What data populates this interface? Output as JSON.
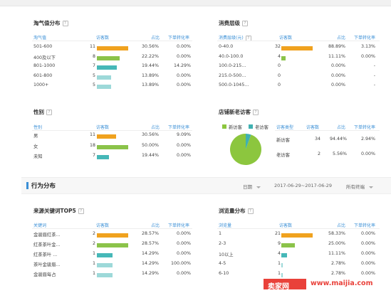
{
  "colors": {
    "accent_blue": "#3a8fd6",
    "bar_orange": "#f0a21f",
    "bar_green": "#8bc34a",
    "bar_teal": "#46b8b8",
    "bar_lightteal": "#9dd9d9",
    "pie_teal": "#3fb1b1",
    "pie_green": "#8cc63e",
    "watermark_red": "#e9413a"
  },
  "naughty": {
    "title": "淘气值分布",
    "help": "?",
    "headers": {
      "label": "淘气值",
      "visitors": "访客数",
      "share": "占比",
      "conversion": "下单转化率"
    },
    "rows": [
      {
        "label": "501-600",
        "visitors": "11",
        "share": "30.56%",
        "conversion": "0.00%",
        "value": 11,
        "color": "orange"
      },
      {
        "label": "400及以下",
        "visitors": "8",
        "share": "22.22%",
        "conversion": "0.00%",
        "value": 8,
        "color": "green"
      },
      {
        "label": "801-1000",
        "visitors": "7",
        "share": "19.44%",
        "conversion": "14.29%",
        "value": 7,
        "color": "teal"
      },
      {
        "label": "601-800",
        "visitors": "5",
        "share": "13.89%",
        "conversion": "0.00%",
        "value": 5,
        "color": "lightteal"
      },
      {
        "label": "1000+",
        "visitors": "5",
        "share": "13.89%",
        "conversion": "0.00%",
        "value": 5,
        "color": "lightteal"
      }
    ]
  },
  "spending": {
    "title": "消费层级",
    "help": "?",
    "headers": {
      "label": "消费层级(元)",
      "help": "?",
      "visitors": "访客数",
      "share": "占比",
      "conversion": "下单转化率"
    },
    "rows": [
      {
        "label": "0-40.0",
        "visitors": "32",
        "share": "88.89%",
        "conversion": "3.13%",
        "value": 32,
        "color": "orange"
      },
      {
        "label": "40.0-100.0",
        "visitors": "4",
        "share": "11.11%",
        "conversion": "0.00%",
        "value": 4,
        "color": "green"
      },
      {
        "label": "100.0-215...",
        "visitors": "0",
        "share": "0.00%",
        "conversion": "-",
        "value": 0,
        "color": "teal"
      },
      {
        "label": "215.0-500...",
        "visitors": "0",
        "share": "0.00%",
        "conversion": "-",
        "value": 0,
        "color": "teal"
      },
      {
        "label": "500.0-1045...",
        "visitors": "0",
        "share": "0.00%",
        "conversion": "-",
        "value": 0,
        "color": "teal"
      }
    ]
  },
  "gender": {
    "title": "性别",
    "help": "?",
    "headers": {
      "label": "性别",
      "visitors": "访客数",
      "share": "占比",
      "conversion": "下单转化率"
    },
    "rows": [
      {
        "label": "男",
        "visitors": "11",
        "share": "30.56%",
        "conversion": "9.09%",
        "value": 11,
        "color": "orange"
      },
      {
        "label": "女",
        "visitors": "18",
        "share": "50.00%",
        "conversion": "0.00%",
        "value": 18,
        "color": "green"
      },
      {
        "label": "未知",
        "visitors": "7",
        "share": "19.44%",
        "conversion": "0.00%",
        "value": 7,
        "color": "teal"
      }
    ]
  },
  "newold": {
    "title": "店铺新老访客",
    "help": "?",
    "legend": {
      "new": "新访客",
      "old": "老访客"
    },
    "headers": {
      "label": "访客类型",
      "visitors": "访客数",
      "share": "占比",
      "conversion": "下单转化率"
    },
    "rows": [
      {
        "label": "新访客",
        "visitors": "34",
        "share": "94.44%",
        "conversion": "2.94%"
      },
      {
        "label": "老访客",
        "visitors": "2",
        "share": "5.56%",
        "conversion": "0.00%"
      }
    ],
    "pie": {
      "new_share": 94.44,
      "old_share": 5.56
    }
  },
  "behavior": {
    "title": "行为分布",
    "date_granularity": "日期",
    "date_range": "2017-06-29~2017-06-29",
    "terminal": "所有终端"
  },
  "keywords": {
    "title": "来源关键词TOP5",
    "help": "?",
    "headers": {
      "label": "关键词",
      "visitors": "访客数",
      "share": "占比",
      "conversion": "下单转化率"
    },
    "rows": [
      {
        "label": "金骏眉红茶...",
        "visitors": "2",
        "share": "28.57%",
        "conversion": "0.00%",
        "value": 2,
        "color": "orange"
      },
      {
        "label": "红茶茶叶金...",
        "visitors": "2",
        "share": "28.57%",
        "conversion": "0.00%",
        "value": 2,
        "color": "green"
      },
      {
        "label": "红茶茶叶 ...",
        "visitors": "1",
        "share": "14.29%",
        "conversion": "0.00%",
        "value": 1,
        "color": "teal"
      },
      {
        "label": "茶叶金骏眉...",
        "visitors": "1",
        "share": "14.29%",
        "conversion": "100.00%",
        "value": 1,
        "color": "lightteal"
      },
      {
        "label": "金骏眉每占",
        "visitors": "1",
        "share": "14.29%",
        "conversion": "0.00%",
        "value": 1,
        "color": "lightteal"
      }
    ]
  },
  "pageviews": {
    "title": "浏览量分布",
    "help": "?",
    "headers": {
      "label": "浏览量",
      "visitors": "访客数",
      "share": "占比",
      "conversion": "下单转化率"
    },
    "rows": [
      {
        "label": "1",
        "visitors": "21",
        "share": "58.33%",
        "conversion": "0.00%",
        "value": 21,
        "color": "orange"
      },
      {
        "label": "2-3",
        "visitors": "9",
        "share": "25.00%",
        "conversion": "0.00%",
        "value": 9,
        "color": "green"
      },
      {
        "label": "10以上",
        "visitors": "4",
        "share": "11.11%",
        "conversion": "0.00%",
        "value": 4,
        "color": "teal"
      },
      {
        "label": "4-5",
        "visitors": "1",
        "share": "2.78%",
        "conversion": "0.00%",
        "value": 1,
        "color": "lightteal"
      },
      {
        "label": "6-10",
        "visitors": "1",
        "share": "2.78%",
        "conversion": "0.00%",
        "value": 1,
        "color": "lightteal"
      }
    ]
  },
  "watermark": {
    "badge": "卖家网",
    "url": "www.maijia.com"
  }
}
